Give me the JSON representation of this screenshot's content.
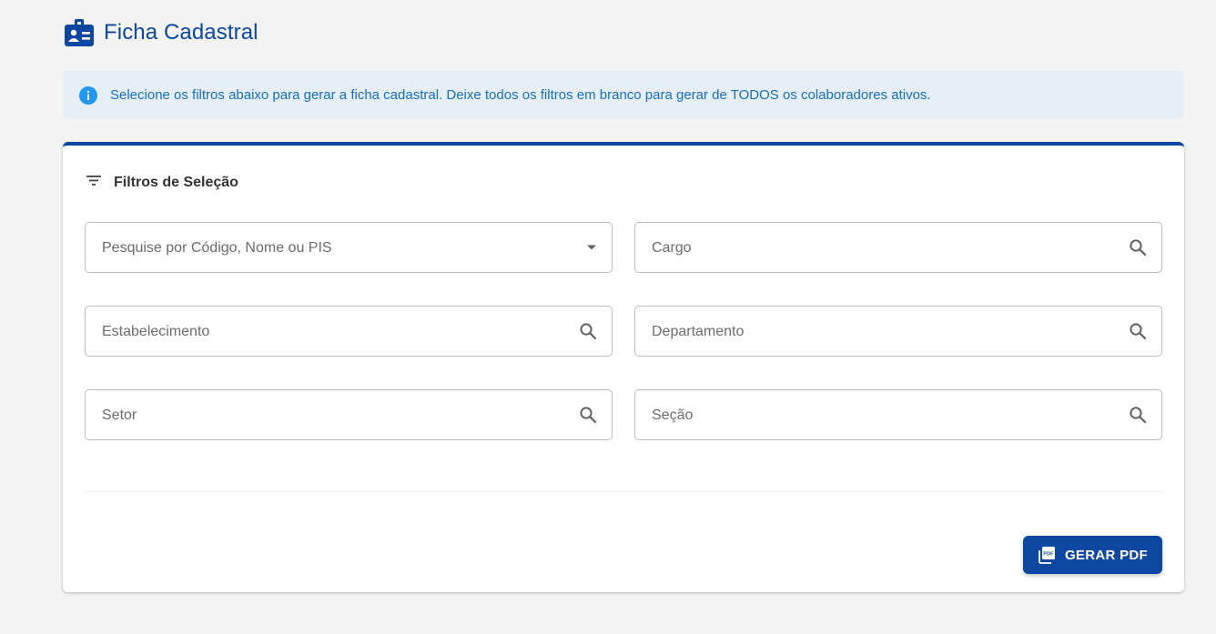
{
  "header": {
    "title": "Ficha Cadastral",
    "icon": "badge-icon"
  },
  "info_banner": {
    "icon": "info-icon",
    "text": "Selecione os filtros abaixo para gerar a ficha cadastral. Deixe todos os filtros em branco para gerar de TODOS os colaboradores ativos."
  },
  "filters": {
    "title": "Filtros de Seleção",
    "icon": "filter-icon",
    "fields": {
      "colaborador": {
        "placeholder": "Pesquise por Código, Nome ou PIS",
        "value": "",
        "icon": "dropdown-arrow-icon"
      },
      "cargo": {
        "placeholder": "Cargo",
        "value": "",
        "icon": "search-icon"
      },
      "estabelecimento": {
        "placeholder": "Estabelecimento",
        "value": "",
        "icon": "search-icon"
      },
      "departamento": {
        "placeholder": "Departamento",
        "value": "",
        "icon": "search-icon"
      },
      "setor": {
        "placeholder": "Setor",
        "value": "",
        "icon": "search-icon"
      },
      "secao": {
        "placeholder": "Seção",
        "value": "",
        "icon": "search-icon"
      }
    }
  },
  "actions": {
    "generate_pdf_label": "GERAR PDF",
    "generate_pdf_icon": "pdf-icon"
  },
  "colors": {
    "primary": "#0d47a1",
    "info_text": "#1a6fc0",
    "info_background": "#e6eef6",
    "page_background": "#f4f4f4"
  }
}
